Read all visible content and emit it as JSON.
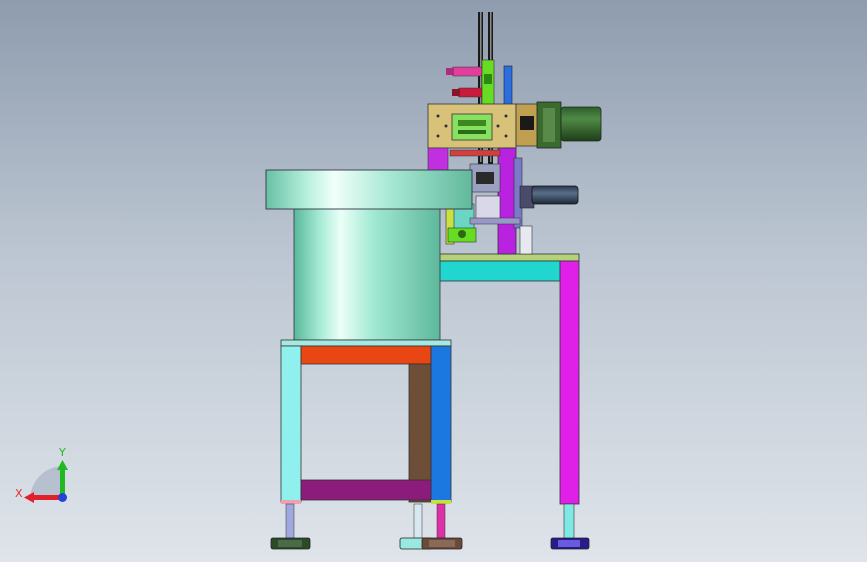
{
  "viewport": {
    "axes": {
      "x_label": "X",
      "y_label": "Y"
    },
    "colors": {
      "x_axis": "#e0202a",
      "y_axis": "#22b822",
      "z_axis": "#2444d8",
      "x_label": "#e03030",
      "y_label": "#22b822"
    }
  }
}
